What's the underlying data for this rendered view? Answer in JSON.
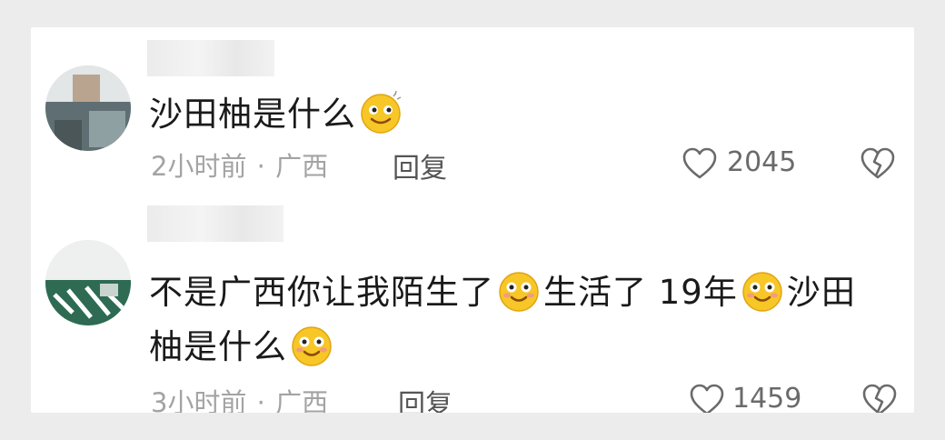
{
  "comments": [
    {
      "text_before": "沙田柚是什么",
      "text_after": "",
      "time": "2小时前",
      "separator": "·",
      "location": "广西",
      "reply_label": "回复",
      "like_count": "2045",
      "emoji_1": "smiling-face-emoji",
      "emoji_2": ""
    },
    {
      "line1_part1": "不是广西你让我陌生了",
      "line1_part2": "生活了 19年",
      "line1_part3": "沙田",
      "line2_part1": "柚是什么",
      "time": "3小时前",
      "separator": "·",
      "location": "广西",
      "reply_label": "回复",
      "like_count": "1459",
      "emoji": "smiling-face-emoji"
    }
  ],
  "colors": {
    "emoji_face": "#f7c627",
    "text": "#1a1a1a",
    "meta": "#a3a3a3"
  }
}
